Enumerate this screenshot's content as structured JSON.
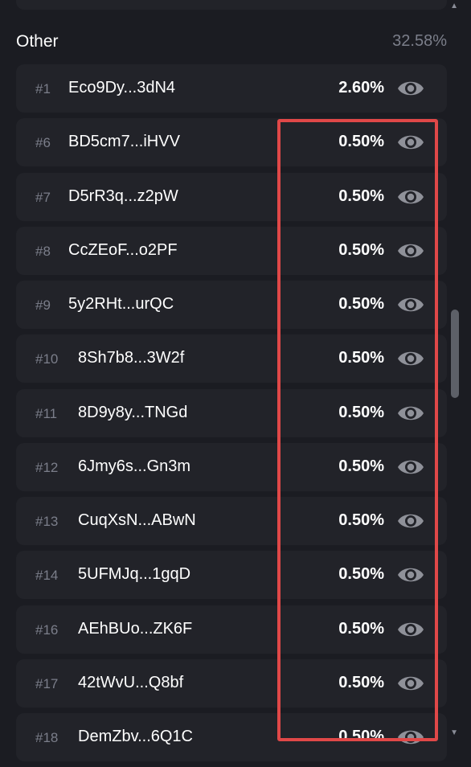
{
  "section": {
    "title": "Other",
    "percent": "32.58%"
  },
  "rows": [
    {
      "rank": "#1",
      "address": "Eco9Dy...3dN4",
      "value": "2.60%"
    },
    {
      "rank": "#6",
      "address": "BD5cm7...iHVV",
      "value": "0.50%"
    },
    {
      "rank": "#7",
      "address": "D5rR3q...z2pW",
      "value": "0.50%"
    },
    {
      "rank": "#8",
      "address": "CcZEoF...o2PF",
      "value": "0.50%"
    },
    {
      "rank": "#9",
      "address": "5y2RHt...urQC",
      "value": "0.50%"
    },
    {
      "rank": "#10",
      "address": "8Sh7b8...3W2f",
      "value": "0.50%"
    },
    {
      "rank": "#11",
      "address": "8D9y8y...TNGd",
      "value": "0.50%"
    },
    {
      "rank": "#12",
      "address": "6Jmy6s...Gn3m",
      "value": "0.50%"
    },
    {
      "rank": "#13",
      "address": "CuqXsN...ABwN",
      "value": "0.50%"
    },
    {
      "rank": "#14",
      "address": "5UFMJq...1gqD",
      "value": "0.50%"
    },
    {
      "rank": "#16",
      "address": "AEhBUo...ZK6F",
      "value": "0.50%"
    },
    {
      "rank": "#17",
      "address": "42tWvU...Q8bf",
      "value": "0.50%"
    },
    {
      "rank": "#18",
      "address": "DemZbv...6Q1C",
      "value": "0.50%"
    }
  ],
  "icons": {
    "row_action": "eye-icon",
    "scroll_up": "caret-up-icon",
    "scroll_down": "caret-down-icon"
  },
  "colors": {
    "background": "#1b1c22",
    "row_background": "#222329",
    "muted_text": "#7b7e8a",
    "eye_icon": "#8f9199",
    "highlight_border": "#e04848"
  },
  "glyphs": {
    "scroll_up": "▲",
    "scroll_down": "▼"
  }
}
